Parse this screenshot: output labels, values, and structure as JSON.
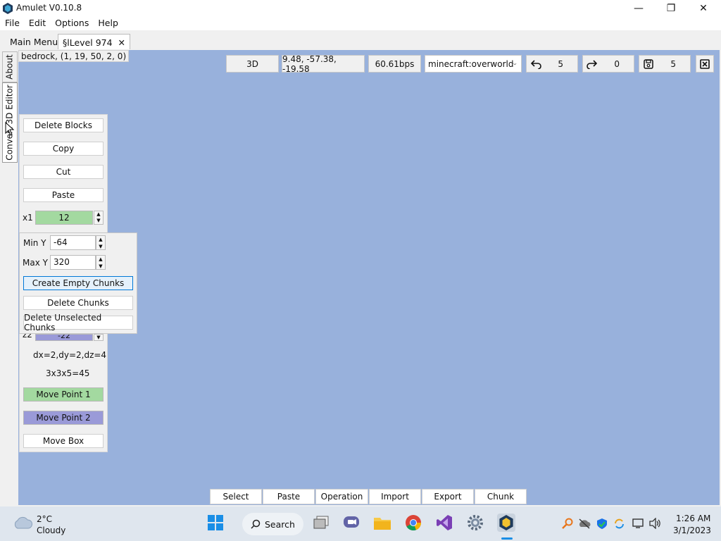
{
  "window": {
    "title": "Amulet V0.10.8",
    "minimize_glyph": "—",
    "restore_glyph": "❐",
    "close_glyph": "✕"
  },
  "menubar": {
    "items": [
      "File",
      "Edit",
      "Options",
      "Help"
    ]
  },
  "tabs": [
    {
      "label": "Main Menu"
    },
    {
      "label": "§lLevel 974",
      "close_glyph": "✕"
    }
  ],
  "side_tabs": {
    "about": "About",
    "editor": "3D Editor",
    "convert": "Convert"
  },
  "status": {
    "block_info": "bedrock, (1, 19, 50, 2, 0)"
  },
  "toolbar": {
    "view_mode": "3D",
    "camera_position": "9.48, -57.38, -19.58",
    "speed": "60.61bps",
    "dimension": "minecraft:overworld",
    "undo_count": "5",
    "redo_count": "0",
    "save_count": "5"
  },
  "tool_panel": {
    "delete_blocks": "Delete Blocks",
    "copy": "Copy",
    "cut": "Cut",
    "paste": "Paste",
    "multiplier_label": "x1",
    "multiplier_value": "12",
    "z2_label": "z2",
    "z2_value": "-22",
    "dimensions_text": "dx=2,dy=2,dz=4",
    "volume_text": "3x3x5=45",
    "move_point_1": "Move Point 1",
    "move_point_2": "Move Point 2",
    "move_box": "Move Box"
  },
  "chunk_popup": {
    "min_y_label": "Min Y",
    "min_y_value": "-64",
    "max_y_label": "Max Y",
    "max_y_value": "320",
    "create_empty": "Create Empty Chunks",
    "delete_chunks": "Delete Chunks",
    "delete_unselected": "Delete Unselected Chunks"
  },
  "bottom_toolbar": [
    "Select",
    "Paste",
    "Operation",
    "Import",
    "Export",
    "Chunk"
  ],
  "taskbar": {
    "weather_temp": "2°C",
    "weather_desc": "Cloudy",
    "search_label": "Search",
    "time": "1:26 AM",
    "date": "3/1/2023"
  },
  "colors": {
    "viewport": "#98b1dc",
    "point1": "#a3d9a0",
    "point2": "#9a9ad8",
    "focus": "#0078d7"
  }
}
